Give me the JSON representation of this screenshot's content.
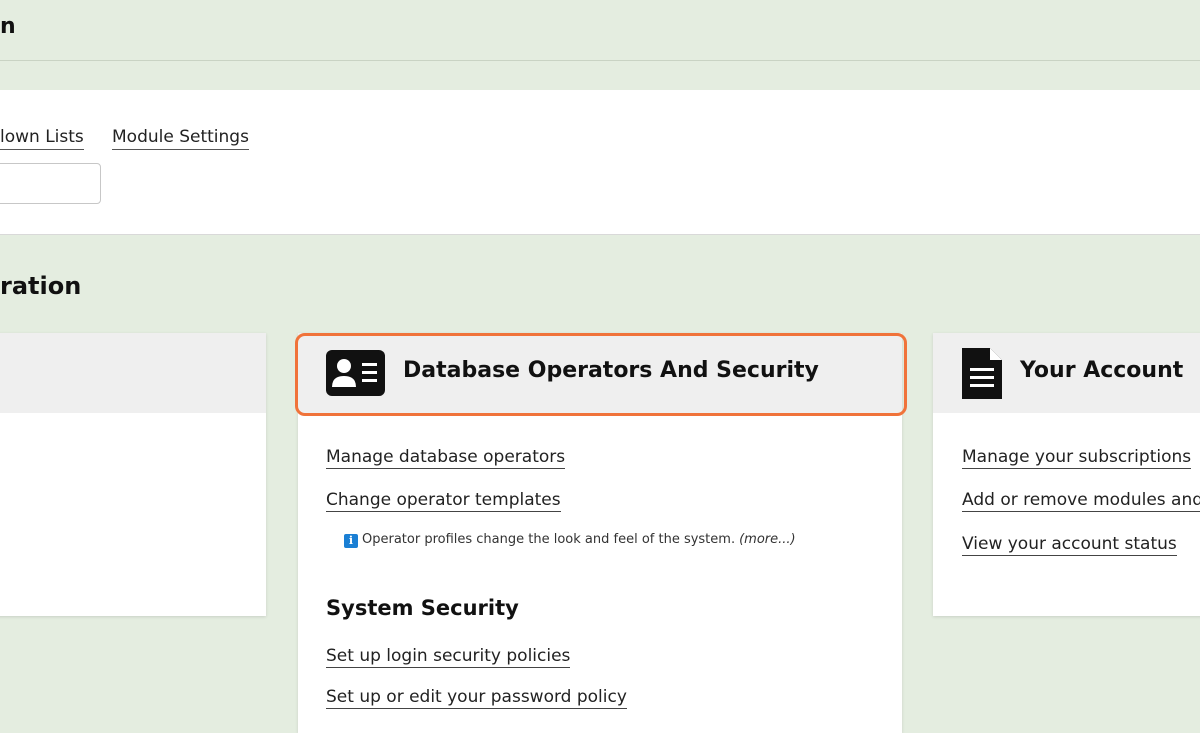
{
  "header": {
    "title_fragment": "n"
  },
  "subnav": {
    "links": [
      {
        "label": "lown Lists"
      },
      {
        "label": "Module Settings"
      }
    ],
    "search_value": ""
  },
  "section": {
    "heading_fragment": "ration"
  },
  "cards": {
    "database": {
      "title": "Database Operators And Security",
      "icon": "id-card-icon",
      "links": [
        {
          "label": "Manage database operators"
        },
        {
          "label": "Change operator templates"
        }
      ],
      "info_text": "Operator profiles change the look and feel of the system.",
      "info_more": "(more...)",
      "subsection_title": "System Security",
      "security_links": [
        {
          "label": "Set up login security policies"
        },
        {
          "label": "Set up or edit your password policy"
        }
      ]
    },
    "account": {
      "title": "Your Account",
      "icon": "document-icon",
      "links": [
        {
          "label": "Manage your subscriptions"
        },
        {
          "label": "Add or remove modules and"
        },
        {
          "label": "View your account status"
        }
      ]
    }
  },
  "colors": {
    "background": "#e4ede0",
    "highlight": "#f0733a",
    "info_icon": "#1a7fd4"
  }
}
